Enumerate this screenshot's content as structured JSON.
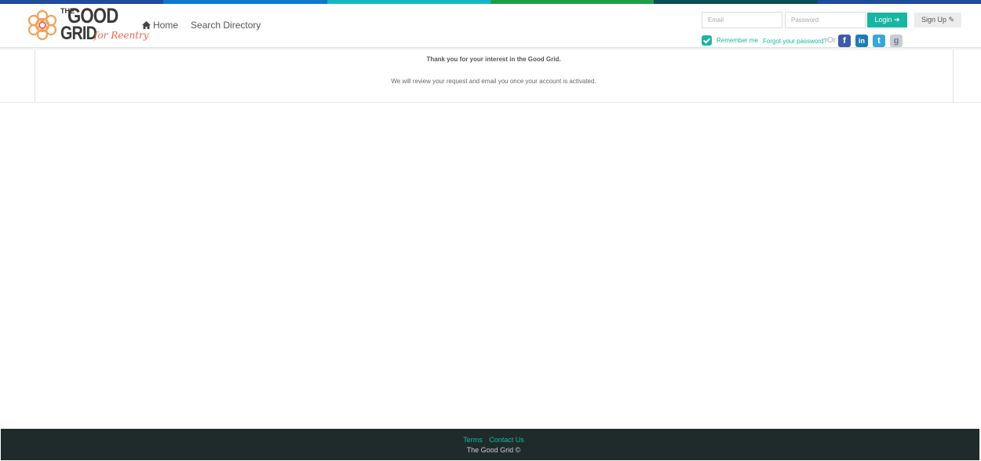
{
  "brand": {
    "logo_the": "THE",
    "logo_good": "GOOD",
    "logo_grid": "GRID",
    "logo_tagline": "for Reentry",
    "topbar_colors": [
      "#1d4c9c",
      "#0f78c8",
      "#17b6c2",
      "#1f9e4a",
      "#0c4f56",
      "#1d4c9c"
    ]
  },
  "nav": {
    "home_label": "Home",
    "search_label": "Search Directory"
  },
  "login": {
    "email_placeholder": "Email",
    "password_placeholder": "Password",
    "login_label": "Login",
    "signup_label": "Sign Up",
    "remember_label": "Remember me",
    "remember_checked": true,
    "forgot_label": "Forgot your password?",
    "or_label": "Or",
    "social": [
      "facebook-icon",
      "linkedin-icon",
      "twitter-icon",
      "google-icon"
    ]
  },
  "main": {
    "title": "Thank you for your interest in the Good Grid.",
    "message": "We will review your request and email you once your account is activated."
  },
  "footer": {
    "terms_label": "Terms",
    "contact_label": "Contact Us",
    "copyright": "The Good Grid ©"
  },
  "colors": {
    "accent": "#17b6a3",
    "footer_bg": "#1f2b2b",
    "brand_orange": "#e8674c"
  }
}
